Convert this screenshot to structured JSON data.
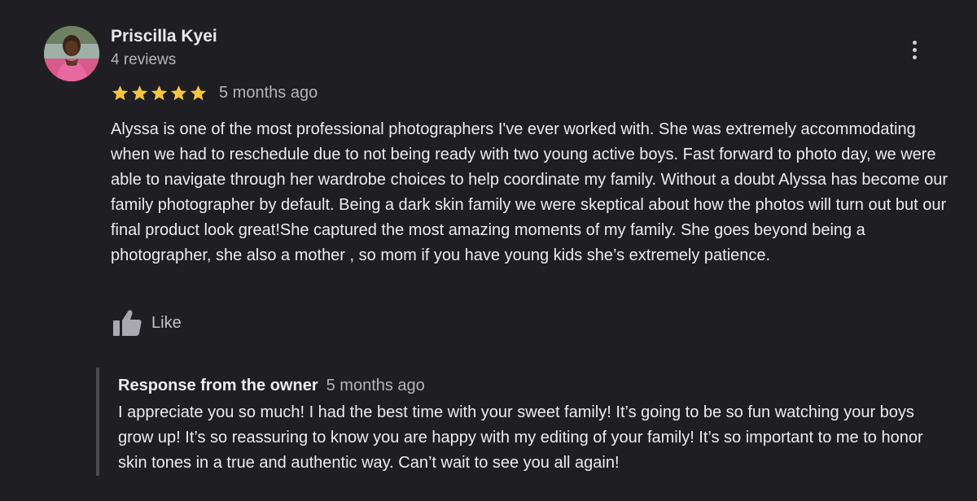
{
  "reviewer": {
    "name": "Priscilla Kyei",
    "review_count": "4 reviews"
  },
  "rating": {
    "stars": 5,
    "max_stars": 5,
    "star_color": "#f5c542",
    "date": "5 months ago"
  },
  "review": {
    "text": "Alyssa is one of the most professional photographers I've ever worked with. She was extremely accommodating when we had to reschedule due to not being ready with two young active boys. Fast forward to photo day, we were able to navigate through her wardrobe choices to help coordinate my family. Without a doubt Alyssa has become our family photographer by default. Being a dark skin family we were skeptical about how the photos will turn out but our final product look great!She captured the most amazing moments of my family. She goes beyond being a photographer, she also a mother , so mom if you have young kids she’s extremely patience."
  },
  "actions": {
    "like_label": "Like",
    "like_icon": "thumbs-up-icon",
    "more_icon": "more-vert-icon"
  },
  "owner_response": {
    "title": "Response from the owner",
    "date": "5 months ago",
    "text": "I appreciate you so much! I had the best time with your sweet family! It’s going to be so fun watching your boys grow up! It’s so reassuring to know you are happy with my editing of your family! It’s so important to me to honor skin tones in a true and authentic way. Can’t wait to see you all again!"
  },
  "colors": {
    "background": "#1f1f23",
    "primary_text": "#ececef",
    "secondary_text": "#b4b4b9",
    "response_border": "#4a4a50"
  }
}
